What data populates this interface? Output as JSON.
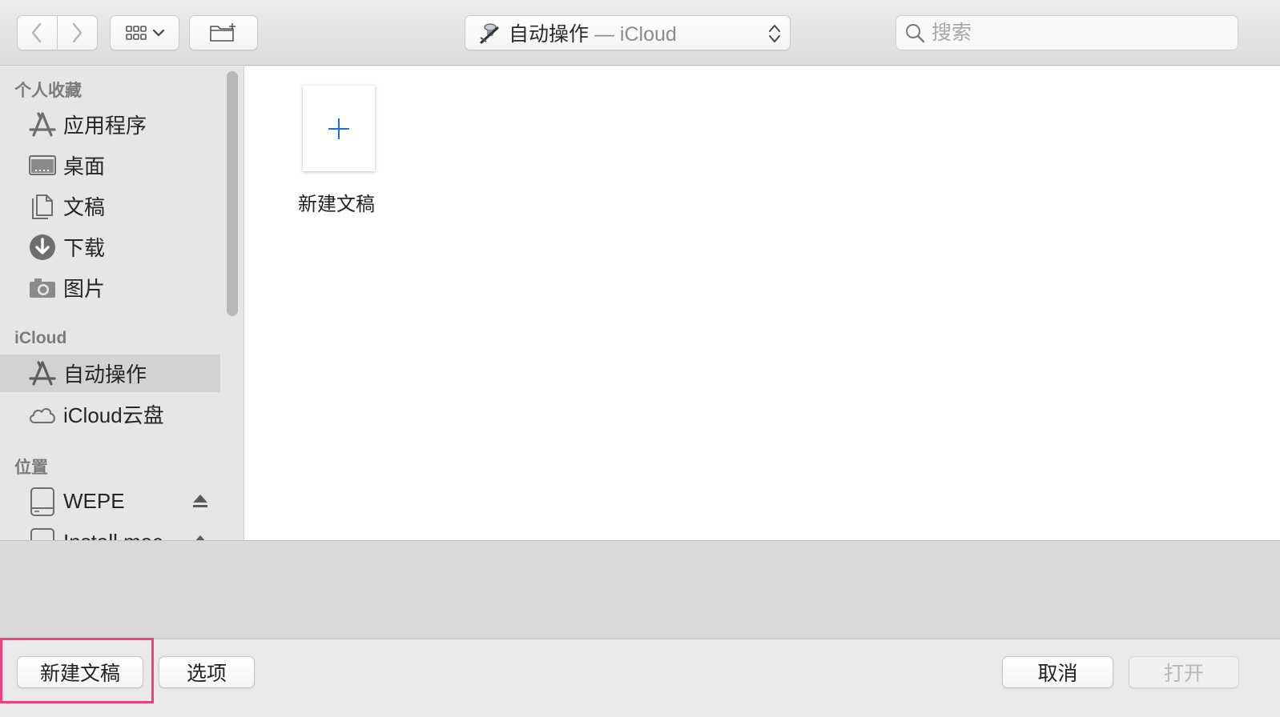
{
  "toolbar": {
    "back_icon": "chevron-left-icon",
    "forward_icon": "chevron-right-icon",
    "view_icon": "icon-grid-icon",
    "new_folder_icon": "new-folder-icon",
    "path": {
      "folder": "自动操作",
      "separator": " — ",
      "location": "iCloud"
    },
    "search_placeholder": "搜索"
  },
  "sidebar": {
    "sections": [
      {
        "title": "个人收藏",
        "items": [
          {
            "label": "应用程序",
            "icon": "applications-icon"
          },
          {
            "label": "桌面",
            "icon": "desktop-icon"
          },
          {
            "label": "文稿",
            "icon": "documents-icon"
          },
          {
            "label": "下载",
            "icon": "downloads-icon"
          },
          {
            "label": "图片",
            "icon": "camera-icon"
          }
        ]
      },
      {
        "title": "iCloud",
        "items": [
          {
            "label": "自动操作",
            "icon": "automator-icon",
            "selected": true
          },
          {
            "label": "iCloud云盘",
            "icon": "cloud-icon"
          }
        ]
      },
      {
        "title": "位置",
        "items": [
          {
            "label": "WEPE",
            "icon": "drive-icon",
            "eject": true
          },
          {
            "label": "Install mac",
            "icon": "drive-icon",
            "eject": true
          }
        ]
      }
    ]
  },
  "content": {
    "items": [
      {
        "label": "新建文稿",
        "icon": "plus-icon"
      }
    ]
  },
  "bottom": {
    "new_document": "新建文稿",
    "options": "选项",
    "cancel": "取消",
    "open": "打开"
  },
  "colors": {
    "accent": "#1a6fd1",
    "highlight": "#ef3f7d",
    "selection": "#d2d2d2"
  }
}
